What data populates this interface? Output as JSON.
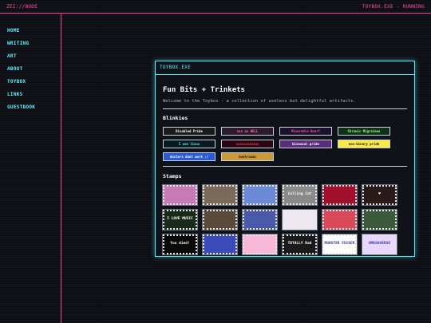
{
  "topbar": {
    "left": "ZEI://NODE",
    "right": "TOYBOX.EXE - RUNNING"
  },
  "sidebar": {
    "items": [
      {
        "label": "HOME"
      },
      {
        "label": "WRITING"
      },
      {
        "label": "ART"
      },
      {
        "label": "ABOUT"
      },
      {
        "label": "TOYBOX"
      },
      {
        "label": "LINKS"
      },
      {
        "label": "GUESTBOOK"
      }
    ]
  },
  "window": {
    "title": "TOYBOX.EXE",
    "heading": "Fun Bits + Trinkets",
    "intro": "Welcome to the Toybox - a collection of useless but delightful artifacts.",
    "blinkies_heading": "Blinkies",
    "stamps_heading": "Stamps",
    "blinkies": [
      {
        "label": "Disabled Pride",
        "bg": "#1a1a1a",
        "fg": "#ffffff"
      },
      {
        "label": "xxx as HELL",
        "bg": "#2a1a2a",
        "fg": "#ff66cc"
      },
      {
        "label": "Miserable Heart",
        "bg": "#1a1030",
        "fg": "#ff4f9a"
      },
      {
        "label": "Chronic Migraines",
        "bg": "#10301a",
        "fg": "#a8ff7a"
      },
      {
        "label": "I use linux",
        "bg": "#061a1f",
        "fg": "#4ff0ff"
      },
      {
        "label": "xxxxxxxxxxxx",
        "bg": "#2a0612",
        "fg": "#ff3355"
      },
      {
        "label": "bisexual pride",
        "bg": "#5a2d7a",
        "fg": "#ffffff"
      },
      {
        "label": "non-binary pride",
        "bg": "#f7e94a",
        "fg": "#222222"
      },
      {
        "label": "doctors dont work :/",
        "bg": "#2a5ad6",
        "fg": "#ffffff"
      },
      {
        "label": "mushrooms",
        "bg": "#c89a3a",
        "fg": "#2a1a06"
      }
    ],
    "stamps": [
      {
        "label": "",
        "bg": "#c77ab8"
      },
      {
        "label": "",
        "bg": "#7a6a5a"
      },
      {
        "label": "",
        "bg": "#6a8ad6"
      },
      {
        "label": "Calling Cat",
        "bg": "#8a8a8a"
      },
      {
        "label": "",
        "bg": "#a0102a"
      },
      {
        "label": "♥",
        "bg": "#2a1a1a"
      },
      {
        "label": "I LOVE MUSIC",
        "bg": "#1a2a1a"
      },
      {
        "label": "",
        "bg": "#5a4a3a"
      },
      {
        "label": "",
        "bg": "#4a5aa8"
      },
      {
        "label": "",
        "bg": "#f0e8f0"
      },
      {
        "label": "",
        "bg": "#d84a5a"
      },
      {
        "label": "",
        "bg": "#3a5a3a"
      },
      {
        "label": "You died!",
        "bg": "#0a0a0a"
      },
      {
        "label": "",
        "bg": "#3a4ab8"
      },
      {
        "label": "",
        "bg": "#f7b8d8"
      },
      {
        "label": "TOTALLY Rad",
        "bg": "#1a1a1a"
      },
      {
        "label": "MONSTER FUCKER",
        "bg": "#ffffff"
      },
      {
        "label": "OMEGAVERSE",
        "bg": "#e8d8ff"
      }
    ]
  }
}
